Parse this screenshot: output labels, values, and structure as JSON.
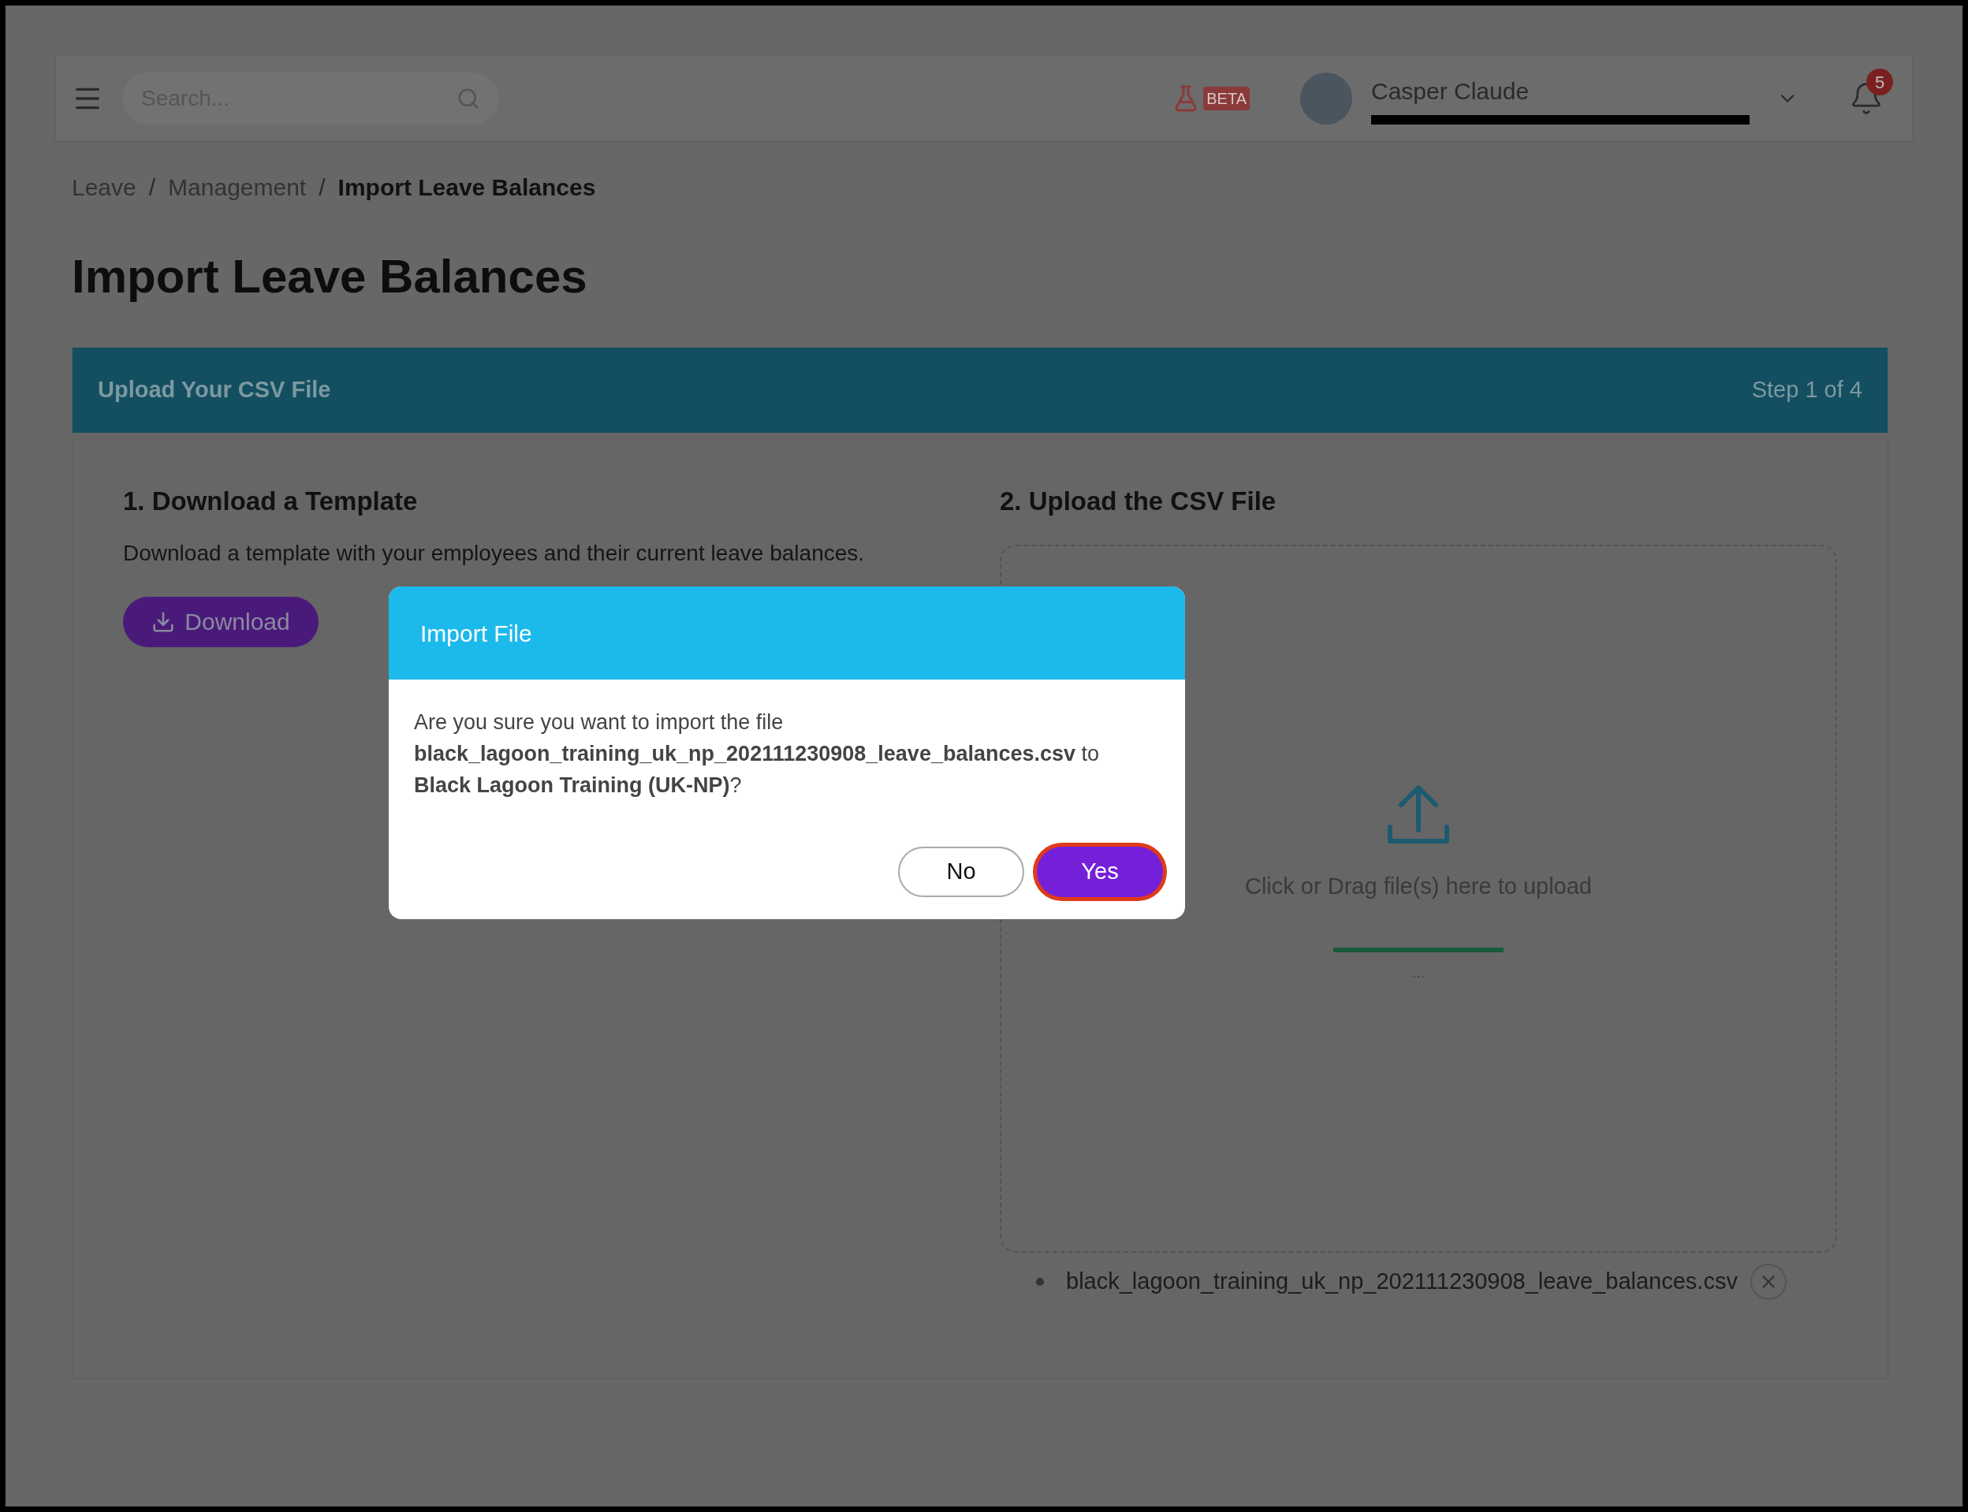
{
  "topbar": {
    "search": {
      "placeholder": "Search..."
    },
    "beta_badge": "BETA",
    "user": {
      "name": "Casper Claude"
    },
    "notifications": "5"
  },
  "breadcrumb": [
    {
      "label": "Leave",
      "current": false
    },
    {
      "label": "Management",
      "current": false
    },
    {
      "label": "Import Leave Balances",
      "current": true
    }
  ],
  "breadcrumb_separator": "/",
  "page_title": "Import Leave Balances",
  "card": {
    "title": "Upload Your CSV File",
    "step": "Step 1 of 4",
    "download": {
      "heading": "1. Download a Template",
      "description": "Download a template with your employees and their current leave balances.",
      "button": "Download"
    },
    "upload": {
      "heading": "2. Upload the CSV File",
      "hint": "Click or Drag file(s) here to upload",
      "progress": {
        "level": 1
      },
      "status": "...",
      "files": [
        "black_lagoon_training_uk_np_202111230908_leave_balances.csv"
      ]
    }
  },
  "dialog": {
    "title": "Import File",
    "message": "Are you sure you want to import the file **black_lagoon_training_uk_np_202111230908_leave_balances.csv** to **Black Lagoon Training (UK-NP)**?",
    "buttons": [
      {
        "label": "No",
        "kind": "secondary",
        "focused": false
      },
      {
        "label": "Yes",
        "kind": "primary",
        "focused": true
      }
    ]
  }
}
